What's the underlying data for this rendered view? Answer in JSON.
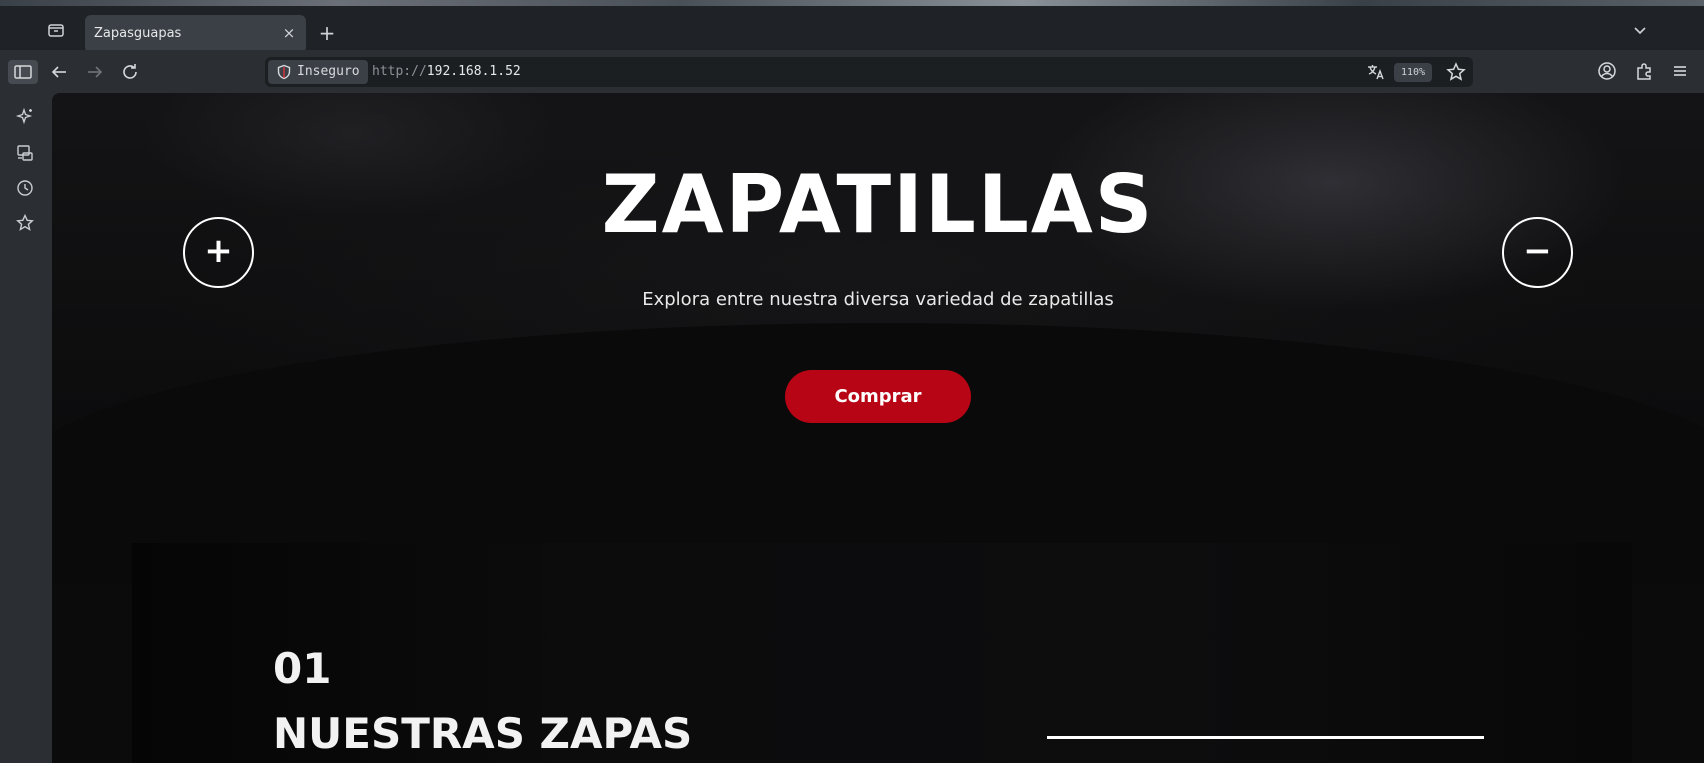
{
  "browser": {
    "tab": {
      "title": "Zapasguapas",
      "close_glyph": "×"
    },
    "new_tab_glyph": "+",
    "url": {
      "security_label": "Inseguro",
      "scheme": "http://",
      "host": "192.168.1.52"
    },
    "zoom": "110%",
    "icons": [
      "panel-icon",
      "tab-list-icon",
      "sidebar-icon",
      "back-icon",
      "forward-icon",
      "reload-icon",
      "translate-icon",
      "bookmark-star-icon",
      "account-icon",
      "extensions-icon",
      "menu-icon",
      "ai-sparkle-icon",
      "synced-tabs-icon",
      "history-icon",
      "bookmarks-icon"
    ]
  },
  "page": {
    "hero": {
      "title": "ZAPATILLAS",
      "subtitle": "Explora entre nuestra diversa variedad de zapatillas",
      "plus_label": "+",
      "minus_label": "−",
      "buy_label": "Comprar"
    },
    "section": {
      "number": "01",
      "title": "NUESTRAS ZAPAS"
    },
    "colors": {
      "accent": "#b80515",
      "background": "#0b0b0c",
      "text": "#ffffff"
    }
  }
}
